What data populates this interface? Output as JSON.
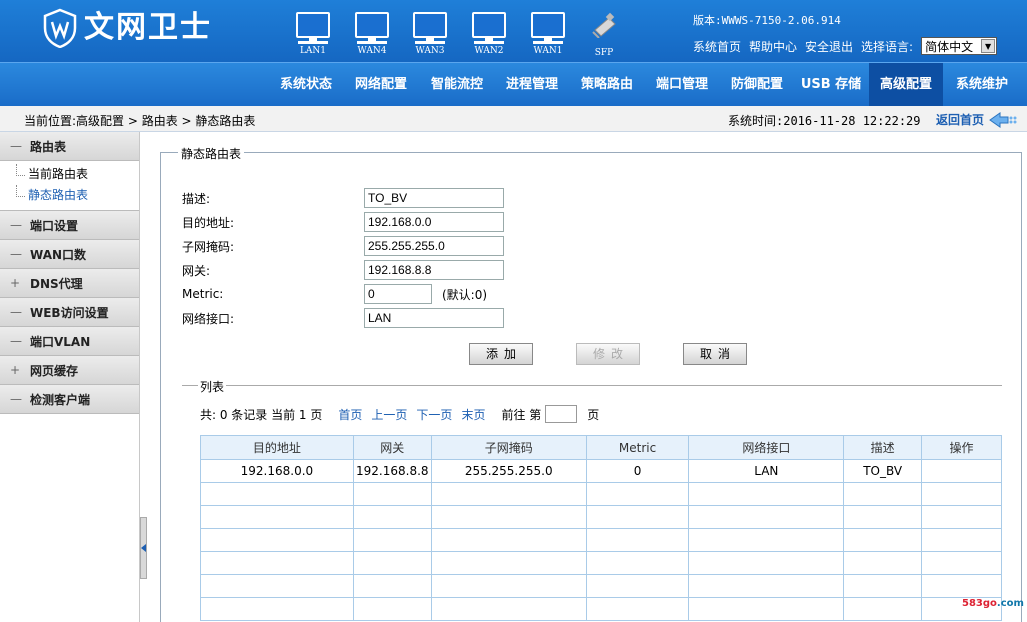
{
  "header": {
    "logo_text": "文网卫士",
    "version": "版本:WWWS-7150-2.06.914",
    "links": [
      "系统首页",
      "帮助中心",
      "安全退出"
    ],
    "lang_label": "选择语言:",
    "lang_value": "简体中文"
  },
  "ports": [
    {
      "label": "LAN1",
      "icon": "monitor-icon"
    },
    {
      "label": "WAN4",
      "icon": "monitor-icon"
    },
    {
      "label": "WAN3",
      "icon": "monitor-icon"
    },
    {
      "label": "WAN2",
      "icon": "monitor-icon"
    },
    {
      "label": "WAN1",
      "icon": "monitor-icon"
    },
    {
      "label": "SFP",
      "icon": "sfp-icon"
    }
  ],
  "nav": {
    "items": [
      "系统状态",
      "网络配置",
      "智能流控",
      "进程管理",
      "策略路由",
      "端口管理",
      "防御配置",
      "USB 存储",
      "高级配置",
      "系统维护"
    ],
    "active": "高级配置"
  },
  "breadcrumb": {
    "path": "当前位置:高级配置 > 路由表 > 静态路由表",
    "time": "系统时间:2016-11-28 12:22:29",
    "home": "返回首页"
  },
  "sidebar": {
    "groups": [
      {
        "sign": "—",
        "label": "路由表",
        "children": [
          "当前路由表",
          "静态路由表"
        ]
      },
      {
        "sign": "—",
        "label": "端口设置"
      },
      {
        "sign": "—",
        "label": "WAN口数"
      },
      {
        "sign": "+",
        "label": "DNS代理"
      },
      {
        "sign": "—",
        "label": "WEB访问设置"
      },
      {
        "sign": "—",
        "label": "端口VLAN"
      },
      {
        "sign": "+",
        "label": "网页缓存"
      },
      {
        "sign": "—",
        "label": "检测客户端"
      }
    ],
    "active_child": "静态路由表"
  },
  "form": {
    "legend": "静态路由表",
    "desc_label": "描述:",
    "desc_value": "TO_BV",
    "dest_label": "目的地址:",
    "dest_value": "192.168.0.0",
    "mask_label": "子网掩码:",
    "mask_value": "255.255.255.0",
    "gw_label": "网关:",
    "gw_value": "192.168.8.8",
    "metric_label": "Metric:",
    "metric_value": "0",
    "metric_hint": "(默认:0)",
    "iface_label": "网络接口:",
    "iface_value": "LAN",
    "btn_add": "添加",
    "btn_edit": "修改",
    "btn_cancel": "取消"
  },
  "list": {
    "legend": "列表",
    "summary": "共: 0 条记录 当前 1 页",
    "first": "首页",
    "prev": "上一页",
    "next": "下一页",
    "last": "末页",
    "goto": "前往 第",
    "page_unit": "页",
    "columns": [
      "目的地址",
      "网关",
      "子网掩码",
      "Metric",
      "网络接口",
      "描述",
      "操作"
    ],
    "rows": [
      [
        "192.168.0.0",
        "192.168.8.8",
        "255.255.255.0",
        "0",
        "LAN",
        "TO_BV",
        ""
      ]
    ]
  },
  "watermark": {
    "a": "583go",
    "b": ".com"
  }
}
